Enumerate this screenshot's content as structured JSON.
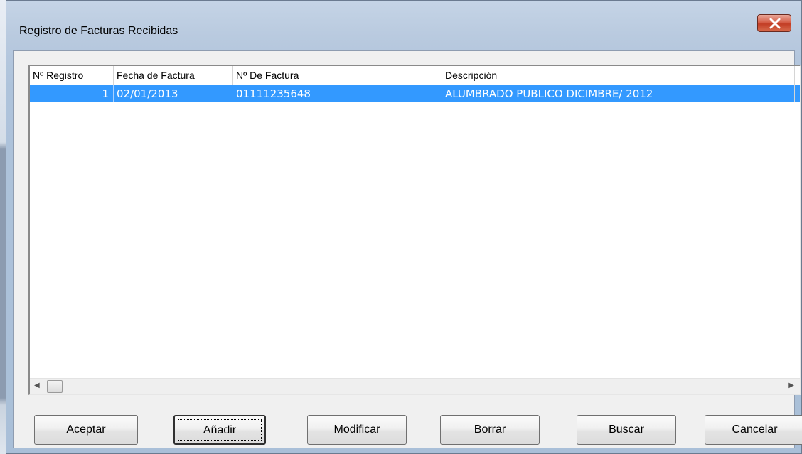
{
  "window": {
    "title": "Registro de Facturas Recibidas",
    "close_icon": "close-icon"
  },
  "table": {
    "columns": [
      "Nº Registro",
      "Fecha de Factura",
      "Nº De Factura",
      "Descripción"
    ],
    "rows": [
      {
        "registro": "1",
        "fecha": "02/01/2013",
        "numero": "01111235648",
        "descripcion": "ALUMBRADO PUBLICO DICIMBRE/ 2012",
        "selected": true
      }
    ],
    "selection_color": "#3399ff"
  },
  "scrollbar": {
    "left_icon": "scroll-left-arrow-icon",
    "right_icon": "scroll-right-arrow-icon"
  },
  "buttons": {
    "aceptar": "Aceptar",
    "anadir": "Añadir",
    "modificar": "Modificar",
    "borrar": "Borrar",
    "buscar": "Buscar",
    "cancelar": "Cancelar"
  }
}
